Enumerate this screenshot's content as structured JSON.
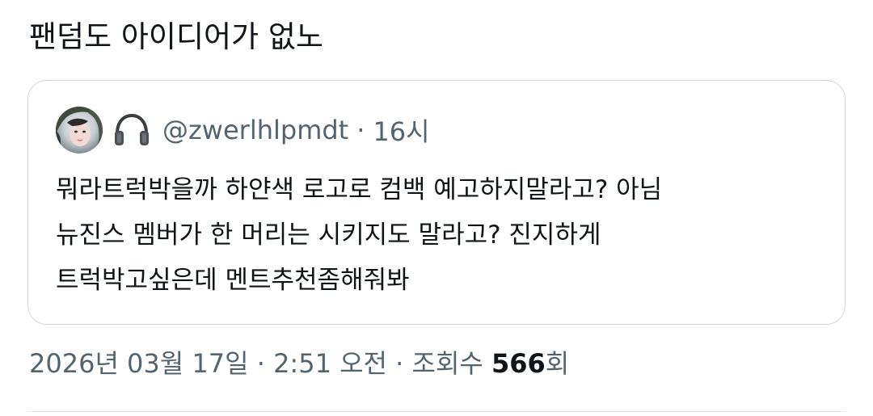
{
  "tweet": {
    "text": "팬덤도 아이디어가 없노"
  },
  "quote": {
    "author_handle": "@zwerlhlpmdt",
    "separator": "·",
    "time": "16시",
    "lines": [
      "뭐라트럭박을까 하얀색 로고로 컴백 예고하지말라고? 아님",
      "뉴진스 멤버가 한 머리는 시키지도 말라고? 진지하게",
      "트럭박고싶은데 멘트추천좀해줘봐"
    ],
    "icons": {
      "avatar": "user-avatar",
      "badge": "headphones-icon"
    }
  },
  "meta": {
    "date": "2026년 03월 17일",
    "separator1": " · ",
    "time": "2:51 오전",
    "separator2": " · ",
    "views_label": "조회수 ",
    "views_count": "566",
    "views_suffix": "회"
  },
  "colors": {
    "text_primary": "#0f1419",
    "text_secondary": "#536471",
    "border": "#cfd9de"
  }
}
